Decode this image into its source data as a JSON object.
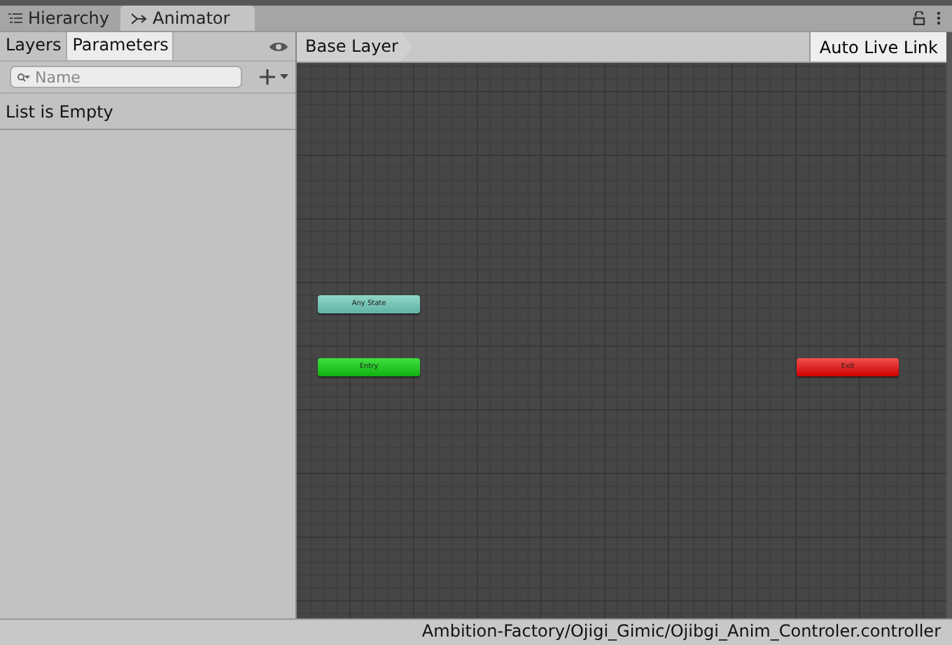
{
  "window_tabs": [
    {
      "label": "Hierarchy",
      "kind": "hierarchy",
      "selected": false
    },
    {
      "label": "Animator",
      "kind": "animator",
      "selected": true
    }
  ],
  "sidebar": {
    "tabs": [
      {
        "label": "Layers",
        "selected": false
      },
      {
        "label": "Parameters",
        "selected": true
      }
    ],
    "search": {
      "placeholder": "Name"
    },
    "empty_message": "List is Empty"
  },
  "toolbar": {
    "breadcrumb": "Base Layer",
    "live_link_button": "Auto Live Link"
  },
  "graph": {
    "nodes": [
      {
        "label": "Any State",
        "kind": "any_state"
      },
      {
        "label": "Entry",
        "kind": "entry"
      },
      {
        "label": "Exit",
        "kind": "exit"
      }
    ]
  },
  "status_bar": "Ambition-Factory/Ojigi_Gimic/Ojibgi_Anim_Controler.controller"
}
